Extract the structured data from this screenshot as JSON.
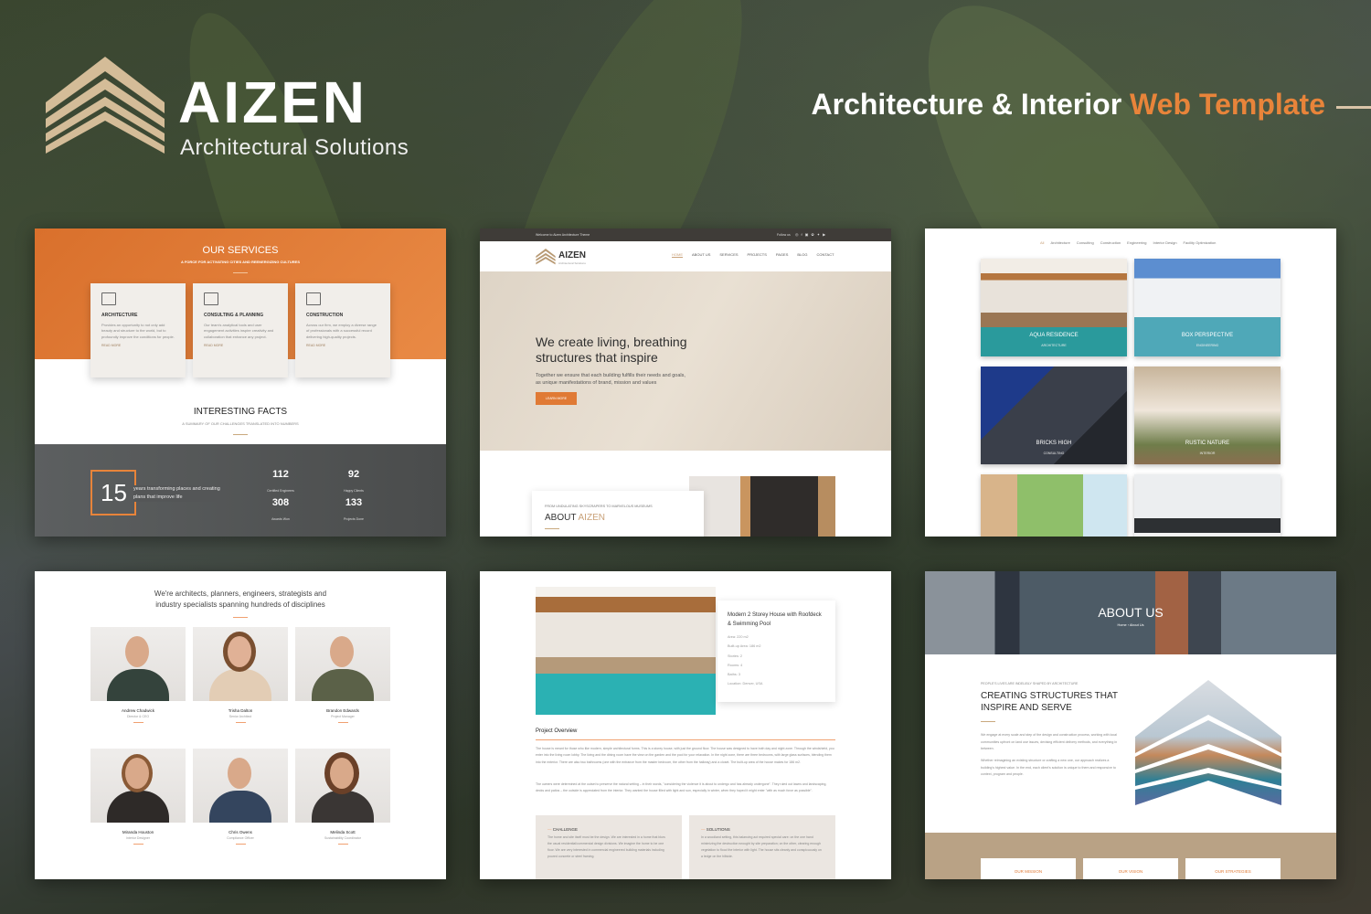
{
  "brand": {
    "name": "AIZEN",
    "tagline": "Architectural Solutions",
    "headline_white": "Architecture & Interior",
    "headline_accent": "Web Template",
    "accent_color": "#e8843a"
  },
  "services_panel": {
    "title": "OUR SERVICES",
    "subtitle": "A FORCE FOR ACTIVATING CITIES AND REENERGIZING CULTURES",
    "cards": [
      {
        "icon": "building-icon",
        "title": "ARCHITECTURE",
        "text": "Provides an opportunity to not only add beauty and structure to the world, but to profoundly improve the conditions for people.",
        "link": "READ MORE"
      },
      {
        "icon": "set-square-icon",
        "title": "CONSULTING & PLANNING",
        "text": "Our team's analytical tools and user engagement activities inspire creativity and collaboration that enhance any project.",
        "link": "READ MORE"
      },
      {
        "icon": "trowel-bricks-icon",
        "title": "CONSTRUCTION",
        "text": "Across our firm, we employ a diverse range of professionals with a successful record delivering high-quality projects.",
        "link": "READ MORE"
      }
    ],
    "facts_title": "INTERESTING FACTS",
    "facts_subtitle": "A SUMMARY OF OUR CHALLENGES TRANSLATED INTO NUMBERS",
    "years": "15",
    "years_text": "years transforming places and creating plans that improve life",
    "stats": [
      {
        "value": "112",
        "label": "Certified Engineers"
      },
      {
        "value": "92",
        "label": "Happy Clients"
      },
      {
        "value": "308",
        "label": "Awards Won"
      },
      {
        "value": "133",
        "label": "Projects Done"
      }
    ]
  },
  "home_panel": {
    "topbar_text": "Welcome to Aizen Architecture Theme",
    "follow": "Follow us",
    "social": [
      "instagram-icon",
      "facebook-icon",
      "linkedin-icon",
      "pinterest-icon",
      "twitter-icon",
      "youtube-icon"
    ],
    "logo_name": "AIZEN",
    "logo_sub": "Architectural Solutions",
    "nav": [
      "HOME",
      "ABOUT US",
      "SERVICES",
      "PROJECTS",
      "PAGES",
      "BLOG",
      "CONTACT"
    ],
    "hero_title": "We create living, breathing structures that inspire",
    "hero_text": "Together we ensure that each building fulfills their needs and goals, as unique manifestations of brand, mission and values",
    "cta": "LEARN MORE",
    "about_kicker": "FROM UNDULATING SKYSCRAPERS TO MARVELOUS MUSEUMS",
    "about_title": "ABOUT",
    "about_accent": "AIZEN"
  },
  "portfolio_panel": {
    "filters": [
      "All",
      "Architecture",
      "Consulting",
      "Construction",
      "Engineering",
      "Interior Design",
      "Facility Optimization"
    ],
    "projects": [
      {
        "title": "AQUA RESIDENCE",
        "category": "ARCHITECTURE"
      },
      {
        "title": "BOX PERSPECTIVE",
        "category": "ENGINEERING"
      },
      {
        "title": "BRICKS HIGH",
        "category": "CONSULTING"
      },
      {
        "title": "RUSTIC NATURE",
        "category": "INTERIOR"
      },
      {
        "title": "",
        "category": ""
      },
      {
        "title": "",
        "category": ""
      }
    ]
  },
  "team_panel": {
    "heading": "We're architects, planners, engineers, strategists and industry specialists spanning hundreds of disciplines",
    "members": [
      {
        "name": "Andrew Chadwick",
        "role": "Director & CEO"
      },
      {
        "name": "Trisha Dalton",
        "role": "Senior Architect"
      },
      {
        "name": "Brandon Edwards",
        "role": "Project Manager"
      },
      {
        "name": "Miranda Houston",
        "role": "Interior Designer"
      },
      {
        "name": "Chris Owens",
        "role": "Compliance Officer"
      },
      {
        "name": "Melinda Scott",
        "role": "Sustainability Coordinator"
      }
    ]
  },
  "project_panel": {
    "title": "Modern 2 Storey House with Roofdeck & Swimming Pool",
    "specs": [
      "Area: 220 m2",
      "Built-up Area: 186 m2",
      "Stories: 2",
      "Rooms: 4",
      "Baths: 3",
      "Location: Denver, USA"
    ],
    "overview_title": "Project Overview",
    "paragraphs": [
      "The house is meant for those who like modern, simple architectural forms. This is a storey house, with just the ground floor. The house was designed to have both day and night zone. Through the windshield, you enter into the living room lobby. The living and the dining room have the view on the garden and the pool for your relaxation. In the night zone, there are three bedrooms, with large glass surfaces, blending them into the exterior. There are also two bathrooms (one with the entrance from the master bedroom, the other from the hallway) and a closet. The built-up area of the house makes for 186 m2.",
      "The owners were determined at the outset to preserve the natural setting – in their words, \"considering the violence it is about to undergo and has already undergone\". They ruled out lawns and landscaping, decks and patios – the outside is appreciated from the interior. They wanted the house filled with light and sun, especially in winter, when they hoped it might enter \"with as much force as possible\"."
    ],
    "challenge_title": "CHALLENGE",
    "challenge_text": "The home and site itself must be the design. We are interested in a home that blurs the usual residential/commercial design divisions. We imagine the home to be one floor. We are very interested in commercial engineered building materials including poured concrete or steel framing.",
    "solutions_title": "SOLUTIONS",
    "solutions_text": "In a woodland setting, this balancing act required special care: on the one hand minimizing the destruction wrought by site preparation; on the other, clearing enough vegetation to flood the interior with light. The house sits cleanly and conspicuously on a ledge on the hillside."
  },
  "about_panel": {
    "title": "ABOUT US",
    "breadcrumb_home": "Home",
    "breadcrumb_current": "About Us",
    "kicker": "PEOPLE'S LIVES ARE INDELIBLY SHAPED BY ARCHITECTURE",
    "heading": "CREATING STRUCTURES THAT INSPIRE AND SERVE",
    "p1": "We engage at every scale and step of the design and construction process, working with local communities upfront on land use issues, devising efficient delivery methods, and everything in between.",
    "p2": "Whether reimagining an existing structure or crafting a new one, our approach realizes a building's highest value. In the end, each client's solution is unique to them and responsive to context, program and people.",
    "boxes": [
      "OUR MISSION",
      "OUR VISION",
      "OUR STRATEGIES"
    ]
  }
}
